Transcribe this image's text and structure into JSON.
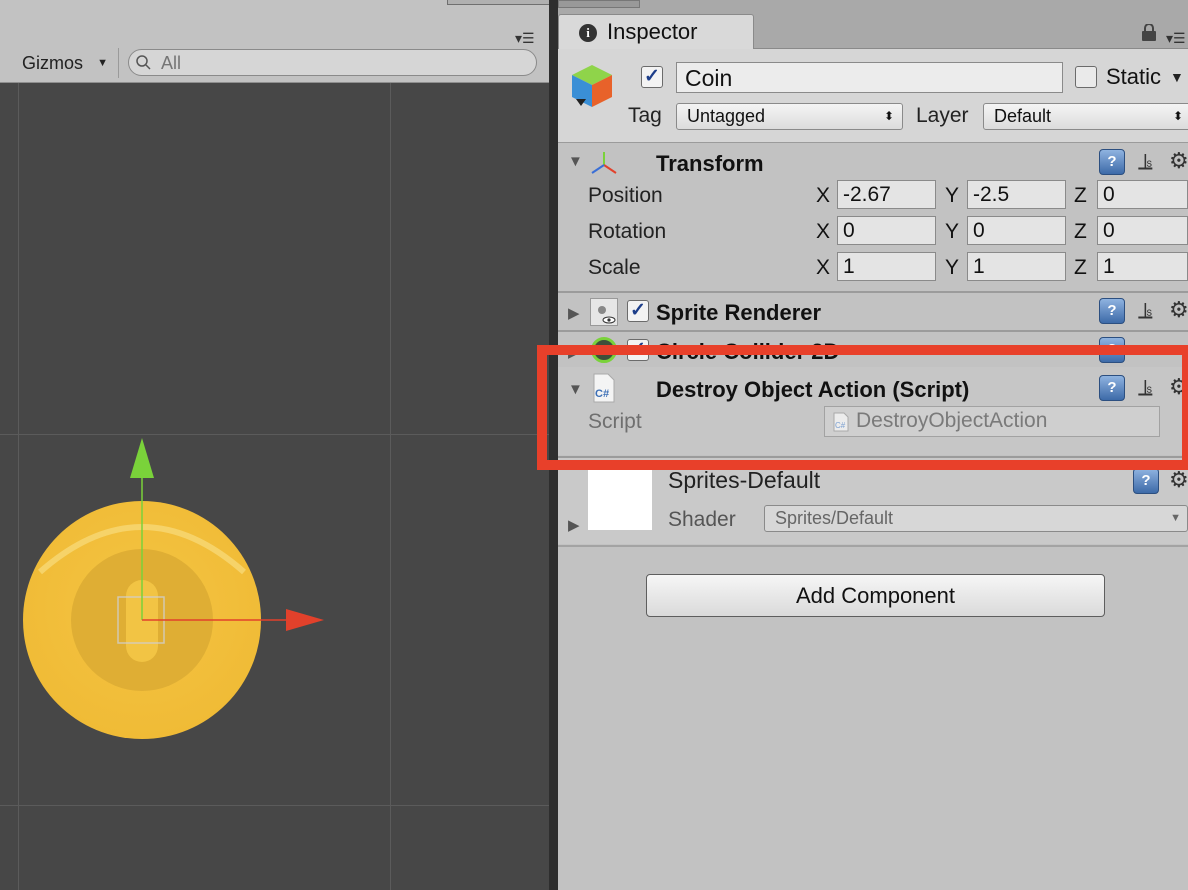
{
  "scene": {
    "gizmos_label": "Gizmos",
    "search_placeholder": "All"
  },
  "inspector": {
    "tab_label": "Inspector",
    "game_object": {
      "active": true,
      "name": "Coin",
      "static_label": "Static",
      "static_checked": false,
      "tag_label": "Tag",
      "tag_value": "Untagged",
      "layer_label": "Layer",
      "layer_value": "Default"
    },
    "transform": {
      "title": "Transform",
      "expanded": true,
      "rows": [
        {
          "label": "Position",
          "x": "-2.67",
          "y": "-2.5",
          "z": "0"
        },
        {
          "label": "Rotation",
          "x": "0",
          "y": "0",
          "z": "0"
        },
        {
          "label": "Scale",
          "x": "1",
          "y": "1",
          "z": "1"
        }
      ],
      "axis_x": "X",
      "axis_y": "Y",
      "axis_z": "Z"
    },
    "sprite_renderer": {
      "title": "Sprite Renderer",
      "enabled": true,
      "expanded": false
    },
    "circle_collider": {
      "title": "Circle Collider 2D",
      "enabled": true,
      "expanded": false
    },
    "destroy_script": {
      "title": "Destroy Object Action (Script)",
      "script_label": "Script",
      "script_value": "DestroyObjectAction",
      "expanded": true
    },
    "material": {
      "name": "Sprites-Default",
      "shader_label": "Shader",
      "shader_value": "Sprites/Default"
    },
    "add_component_label": "Add Component"
  },
  "colors": {
    "highlight": "#e8402a",
    "coin_outer": "#f4c443",
    "coin_inner": "#dfae34",
    "gizmo_x": "#e2412b",
    "gizmo_y": "#7ad23a",
    "scene_bg": "#474747",
    "inspector_bg": "#c2c2c2"
  },
  "icons": [
    "search-icon",
    "info-icon",
    "lock-icon",
    "menu-icon",
    "cube-icon",
    "transform-icon",
    "help-icon",
    "preset-icon",
    "gear-icon",
    "sprite-renderer-icon",
    "circle-collider-icon",
    "cs-script-icon"
  ]
}
